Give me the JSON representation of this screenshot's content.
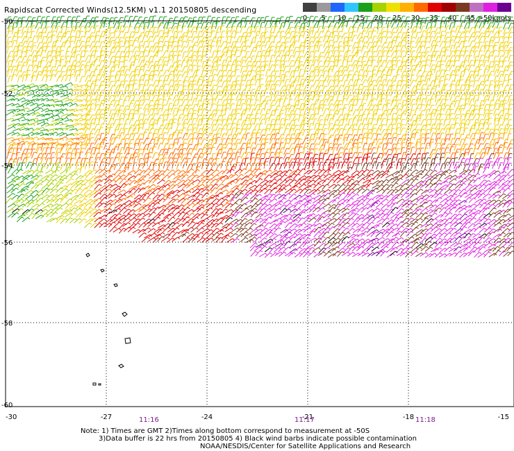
{
  "header": {
    "title": "Rapidscat Corrected Winds(12.5KM) v1.1 20150805 descending"
  },
  "legend": {
    "labels": [
      "0",
      "5",
      "10",
      "15",
      "20",
      "25",
      "30",
      "35",
      "40",
      "45",
      ">50"
    ],
    "unit": "knots",
    "colors": [
      "#404040",
      "#9a9a9a",
      "#1f66ff",
      "#2fc6ff",
      "#1aa01a",
      "#a6d200",
      "#f0e000",
      "#ffb000",
      "#ff6a00",
      "#e00000",
      "#a00000",
      "#7a3a20",
      "#c070c0",
      "#e020e0",
      "#6a0090"
    ]
  },
  "map": {
    "lat_labels": [
      "-50",
      "-52",
      "-54",
      "-56",
      "-58",
      "-60"
    ],
    "lon_labels": [
      "-30",
      "-27",
      "-24",
      "-21",
      "-18",
      "-15"
    ],
    "time_labels": [
      "11:16",
      "11:17",
      "11:18"
    ],
    "wind_regions": [
      {
        "zone": "north",
        "dominant_speed_knots": 25
      },
      {
        "zone": "center",
        "dominant_speed_knots": 35
      },
      {
        "zone": "southeast",
        "dominant_speed_knots": 45
      },
      {
        "zone": "west",
        "dominant_speed_knots": 20
      }
    ]
  },
  "footer": {
    "line1": "Note: 1) Times are GMT 2)Times along bottom correspond to measurement at -50S",
    "line2": "3)Data buffer is 22 hrs from 20150805 4) Black wind barbs indicate possible contamination",
    "line3": "NOAA/NESDIS/Center for Satellite Applications and Research"
  }
}
